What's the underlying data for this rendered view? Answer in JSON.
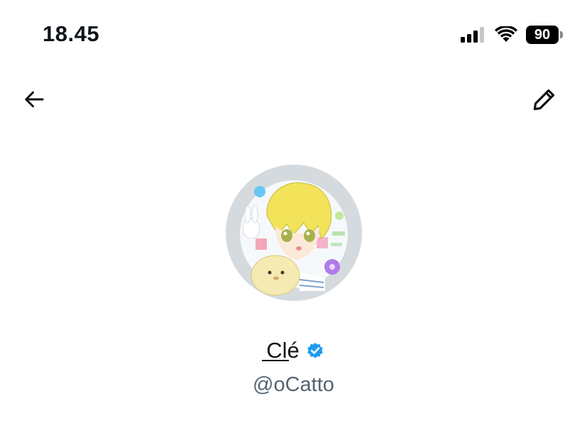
{
  "status_bar": {
    "time": "18.45",
    "battery_level": "90",
    "icons": [
      "cellular-signal-icon",
      "wifi-icon",
      "battery-icon"
    ]
  },
  "nav": {
    "back_icon": "back-arrow-icon",
    "edit_icon": "pencil-icon"
  },
  "profile": {
    "avatar_icon": "avatar-image",
    "name": "Clé",
    "verified_icon": "verified-badge-icon",
    "handle": "@oCatto"
  },
  "colors": {
    "text_primary": "#0f1419",
    "text_secondary": "#536471",
    "verified_blue": "#1d9bf0",
    "avatar_bg": "#d4dade"
  }
}
